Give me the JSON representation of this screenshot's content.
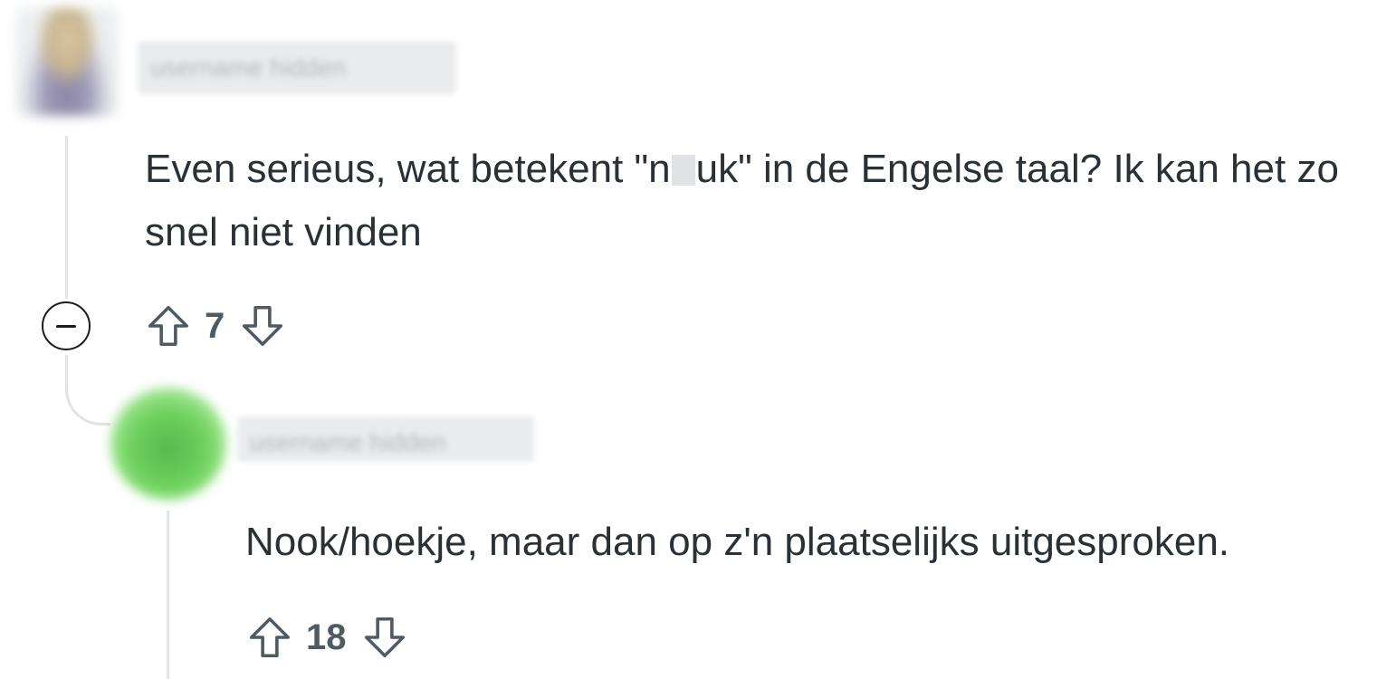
{
  "comments": [
    {
      "author": "username hidden",
      "body_before": "Even serieus, wat betekent \"n",
      "body_after": "uk\" in de Engelse taal? Ik kan het zo snel niet vinden",
      "score": "7"
    },
    {
      "author": "username hidden",
      "body": "Nook/hoekje, maar dan op z'n plaatselijks uitgesproken.",
      "score": "18"
    }
  ],
  "icons": {
    "upvote": "arrow-up-outline-icon",
    "downvote": "arrow-down-outline-icon",
    "collapse": "minus-circle-icon"
  },
  "colors": {
    "text": "#2a3136",
    "vote_text": "#4f5b63",
    "thread_line": "#e1e4e6",
    "avatar_2": "#6fd25e"
  }
}
